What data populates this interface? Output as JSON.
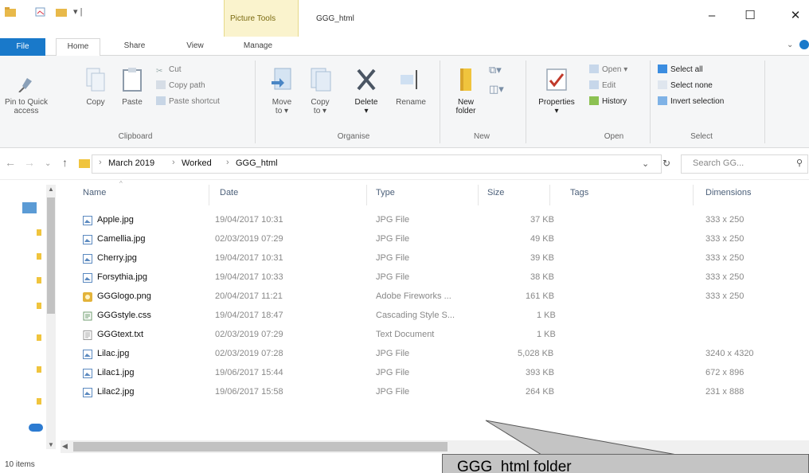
{
  "window": {
    "title": "GGG_html",
    "context_tab": "Picture Tools",
    "controls": [
      "–",
      "☐",
      "✕"
    ]
  },
  "ribbon_tabs": {
    "file": "File",
    "home": "Home",
    "share": "Share",
    "view": "View",
    "manage": "Manage"
  },
  "clipboard": {
    "pin_line1": "Pin to Quick",
    "pin_line2": "access",
    "copy": "Copy",
    "paste": "Paste",
    "cut": "Cut",
    "copy_path": "Copy path",
    "paste_shortcut": "Paste shortcut",
    "label": "Clipboard"
  },
  "organise": {
    "move_line1": "Move",
    "move_line2": "to ▾",
    "copy_line1": "Copy",
    "copy_line2": "to ▾",
    "delete": "Delete",
    "delete_arrow": "▾",
    "rename": "Rename",
    "label": "Organise"
  },
  "new": {
    "folder_line1": "New",
    "folder_line2": "folder",
    "label": "New"
  },
  "open": {
    "properties": "Properties",
    "properties_arrow": "▾",
    "open": "Open ▾",
    "edit": "Edit",
    "history": "History",
    "label": "Open"
  },
  "select": {
    "select_all": "Select all",
    "select_none": "Select none",
    "invert": "Invert selection",
    "label": "Select"
  },
  "address": {
    "crumbs": [
      "March 2019",
      "Worked",
      "GGG_html"
    ],
    "search_placeholder": "Search GG..."
  },
  "columns": {
    "name": "Name",
    "date": "Date",
    "type": "Type",
    "size": "Size",
    "tags": "Tags",
    "dimensions": "Dimensions"
  },
  "files": [
    {
      "name": "Apple.jpg",
      "date": "19/04/2017 10:31",
      "type": "JPG File",
      "size": "37 KB",
      "dims": "333 x 250",
      "icon": "image-file-icon"
    },
    {
      "name": "Camellia.jpg",
      "date": "02/03/2019 07:29",
      "type": "JPG File",
      "size": "49 KB",
      "dims": "333 x 250",
      "icon": "image-file-icon"
    },
    {
      "name": "Cherry.jpg",
      "date": "19/04/2017 10:31",
      "type": "JPG File",
      "size": "39 KB",
      "dims": "333 x 250",
      "icon": "image-file-icon"
    },
    {
      "name": "Forsythia.jpg",
      "date": "19/04/2017 10:33",
      "type": "JPG File",
      "size": "38 KB",
      "dims": "333 x 250",
      "icon": "image-file-icon"
    },
    {
      "name": "GGGlogo.png",
      "date": "20/04/2017 11:21",
      "type": "Adobe Fireworks ...",
      "size": "161 KB",
      "dims": "333 x 250",
      "icon": "fireworks-file-icon"
    },
    {
      "name": "GGGstyle.css",
      "date": "19/04/2017 18:47",
      "type": "Cascading Style S...",
      "size": "1 KB",
      "dims": "",
      "icon": "css-file-icon"
    },
    {
      "name": "GGGtext.txt",
      "date": "02/03/2019 07:29",
      "type": "Text Document",
      "size": "1 KB",
      "dims": "",
      "icon": "text-file-icon"
    },
    {
      "name": "Lilac.jpg",
      "date": "02/03/2019 07:28",
      "type": "JPG File",
      "size": "5,028 KB",
      "dims": "3240 x 4320",
      "icon": "image-file-icon"
    },
    {
      "name": "Lilac1.jpg",
      "date": "19/06/2017 15:44",
      "type": "JPG File",
      "size": "393 KB",
      "dims": "672 x 896",
      "icon": "image-file-icon"
    },
    {
      "name": "Lilac2.jpg",
      "date": "19/06/2017 15:58",
      "type": "JPG File",
      "size": "264 KB",
      "dims": "231 x 888",
      "icon": "image-file-icon"
    }
  ],
  "status": {
    "items": "10 items"
  },
  "callout": {
    "text": "GGG_html folder"
  },
  "colors": {
    "file_tab": "#1979ca",
    "context_tab": "#faf3cd",
    "callout_fill": "#c4c4c4"
  }
}
